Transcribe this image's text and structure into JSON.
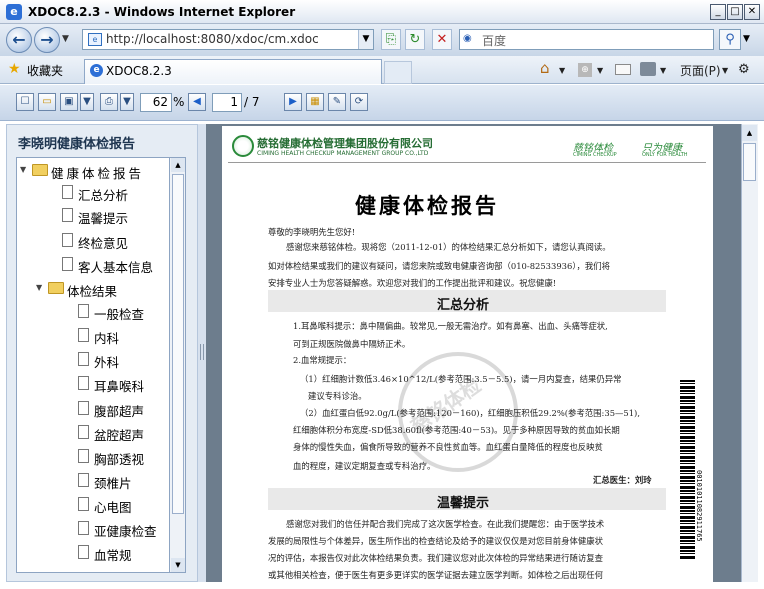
{
  "window": {
    "title": "XDOC8.2.3 - Windows Internet Explorer",
    "icon_letter": "e",
    "minimize": "_",
    "maximize": "□",
    "close": "✕"
  },
  "nav": {
    "back_icon": "←",
    "forward_icon": "→",
    "history_arrow": "▼",
    "url": "http://localhost:8080/xdoc/cm.xdoc",
    "address_dropdown": "▼",
    "compat_icon": "⎘",
    "refresh_icon": "↻",
    "stop_icon": "✕",
    "search_placeholder": "百度",
    "search_logo": "◉",
    "search_button_icon": "⚲",
    "search_dropdown": "▼"
  },
  "favbar": {
    "favorites_label": "收藏夹",
    "star_icon": "★",
    "tab_icon": "e",
    "tab_title": "XDOC8.2.3",
    "home_icon": "⌂",
    "arrow": "▼",
    "feeds_icon": "⊕",
    "page_menu": "页面(P)",
    "tools_icon": "⚙"
  },
  "viewer_toolbar": {
    "icons": {
      "new": "☐",
      "open": "▭",
      "save": "▣",
      "save_arrow": "▼",
      "print": "⎙",
      "print_arrow": "▼",
      "prev": "◀",
      "next": "▶",
      "grid": "▦",
      "props": "✎",
      "refresh": "⟳"
    },
    "zoom": "62",
    "zoom_unit": "%",
    "page_current": "1",
    "page_total": "/ 7"
  },
  "left_panel": {
    "title": "李晓明健康体检报告",
    "tree": [
      {
        "label": "健康体检报告",
        "type": "folder",
        "expanded": true,
        "level": 0
      },
      {
        "label": "汇总分析",
        "type": "doc",
        "level": 1
      },
      {
        "label": "温馨提示",
        "type": "doc",
        "level": 1
      },
      {
        "label": "终检意见",
        "type": "doc",
        "level": 1
      },
      {
        "label": "客人基本信息",
        "type": "doc",
        "level": 1
      },
      {
        "label": "体检结果",
        "type": "folder",
        "expanded": true,
        "level": 1
      },
      {
        "label": "一般检查",
        "type": "doc",
        "level": 2
      },
      {
        "label": "内科",
        "type": "doc",
        "level": 2
      },
      {
        "label": "外科",
        "type": "doc",
        "level": 2
      },
      {
        "label": "耳鼻喉科",
        "type": "doc",
        "level": 2
      },
      {
        "label": "腹部超声",
        "type": "doc",
        "level": 2
      },
      {
        "label": "盆腔超声",
        "type": "doc",
        "level": 2
      },
      {
        "label": "胸部透视",
        "type": "doc",
        "level": 2
      },
      {
        "label": "颈椎片",
        "type": "doc",
        "level": 2
      },
      {
        "label": "心电图",
        "type": "doc",
        "level": 2
      },
      {
        "label": "亚健康检查",
        "type": "doc",
        "level": 2
      },
      {
        "label": "血常规",
        "type": "doc",
        "level": 2
      }
    ],
    "scroll_up": "▲",
    "scroll_down": "▼"
  },
  "document": {
    "company_name": "慈铭健康体检管理集团股份有限公司",
    "company_en": "CIMING HEALTH CHECKUP MANAGEMENT GROUP CO.,LTD",
    "slogan_left": "慈铭体检",
    "slogan_left_en": "CIMING CHECKUP",
    "slogan_right": "只为健康",
    "slogan_right_en": "ONLY FOR HEALTH",
    "report_title": "健康体检报告",
    "greeting": "尊敬的李晓明先生您好!",
    "intro_lines": [
      "感谢您来慈铭体检。现将您（2011-12-01）的体检结果汇总分析如下，请您认真阅读。",
      "如对体检结果或我们的建议有疑问，请您来院或致电健康咨询部（010-82533936），我们将",
      "安排专业人士为您答疑解惑。欢迎您对我们的工作提出批评和建议。祝您健康!"
    ],
    "section1_title": "汇总分析",
    "section1_lines": [
      "1.耳鼻喉科提示：鼻中隔偏曲。较常见,一般无需治疗。如有鼻塞、出血、头痛等症状,",
      "可到正规医院做鼻中隔矫正术。",
      "2.血常规提示：",
      "（1）红细胞计数低3.46×10^12/L(参考范围:3.5－5.5)，请一月内复查，结果仍异常",
      "建议专科诊治。",
      "（2）血红蛋白低92.0g/L(参考范围:120－160)，红细胞压积低29.2%(参考范围:35—51),",
      "红细胞体积分布宽度-SD低38.60fl(参考范围:40－53)。见于多种原因导致的贫血如长期",
      "身体的慢性失血，偏食所导致的营养不良性贫血等。血红蛋白量降低的程度也反映贫",
      "血的程度，建议定期复查或专科治疗。"
    ],
    "summary_doctor": "汇总医生：刘玲",
    "section2_title": "温馨提示",
    "section2_lines": [
      "感谢您对我们的信任并配合我们完成了这次医学检查。在此我们提醒您：由于医学技术",
      "发展的局限性与个体差异，医生所作出的检查结论及给予的建议仅仅是对您目前身体健康状",
      "况的评估，本报告仅对此次体检结果负责。我们建议您对此次体检的异常结果进行随访复查",
      "或其他相关检查，便于医生有更多更详实的医学证据去建立医学判断。如体检之后出现任何"
    ],
    "barcode_number": "00101011082911765",
    "watermark": "慈铭体检"
  },
  "doc_scroll": {
    "up": "▲"
  }
}
